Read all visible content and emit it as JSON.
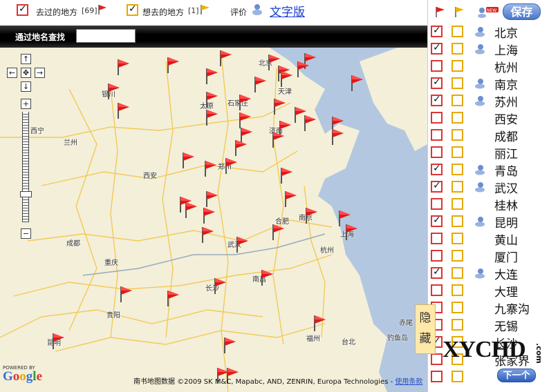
{
  "topbar": {
    "visited_label": "去过的地方",
    "visited_count": "[69]",
    "wish_label": "想去的地方",
    "wish_count": "[1]",
    "rate_label": "评价",
    "text_version_link": "文字版"
  },
  "search": {
    "label": "通过地名查找",
    "placeholder": ""
  },
  "map": {
    "cities": [
      "北京",
      "银川",
      "太原",
      "石家庄",
      "天津",
      "西宁",
      "兰州",
      "济南",
      "郑州",
      "西安",
      "合肥",
      "南京",
      "上海",
      "成都",
      "武汉",
      "杭州",
      "重庆",
      "长沙",
      "南昌",
      "贵阳",
      "福州",
      "台北",
      "赤尾",
      "钓鱼岛",
      "昆明"
    ],
    "powered_by": "POWERED BY",
    "provider_logo": "Google",
    "attribution": "南书地图数据 ©2009 SK M&C, Mapabc, AND, ZENRIN, Europa Technologies - ",
    "terms_link": "使用条款",
    "hide_tab": [
      "隐",
      "藏"
    ],
    "land_color": "#f3efd9",
    "sea_color": "#b3c7e0"
  },
  "zoom": {
    "up": "↑",
    "left": "←",
    "center": "✥",
    "right": "→",
    "down": "↓",
    "zoom_in": "+",
    "zoom_out": "−"
  },
  "panel": {
    "visited_header_icon": "red-flag-icon",
    "wish_header_icon": "yellow-flag-icon",
    "rate_header_icon": "new-rating-icon",
    "save_label": "保存",
    "next_label": "下一个",
    "rows": [
      {
        "name": "北京",
        "visited": true,
        "wish": false,
        "rated": true
      },
      {
        "name": "上海",
        "visited": true,
        "wish": false,
        "rated": true
      },
      {
        "name": "杭州",
        "visited": false,
        "wish": false,
        "rated": false
      },
      {
        "name": "南京",
        "visited": true,
        "wish": false,
        "rated": true
      },
      {
        "name": "苏州",
        "visited": true,
        "wish": false,
        "rated": true
      },
      {
        "name": "西安",
        "visited": false,
        "wish": false,
        "rated": false
      },
      {
        "name": "成都",
        "visited": false,
        "wish": false,
        "rated": false
      },
      {
        "name": "丽江",
        "visited": false,
        "wish": false,
        "rated": false
      },
      {
        "name": "青岛",
        "visited": true,
        "wish": false,
        "rated": true
      },
      {
        "name": "武汉",
        "visited": true,
        "wish": false,
        "rated": true
      },
      {
        "name": "桂林",
        "visited": false,
        "wish": false,
        "rated": false
      },
      {
        "name": "昆明",
        "visited": true,
        "wish": false,
        "rated": true
      },
      {
        "name": "黄山",
        "visited": false,
        "wish": false,
        "rated": false
      },
      {
        "name": "厦门",
        "visited": false,
        "wish": false,
        "rated": false
      },
      {
        "name": "大连",
        "visited": true,
        "wish": false,
        "rated": true
      },
      {
        "name": "大理",
        "visited": false,
        "wish": false,
        "rated": false
      },
      {
        "name": "九寨沟",
        "visited": false,
        "wish": false,
        "rated": false
      },
      {
        "name": "无锡",
        "visited": false,
        "wish": false,
        "rated": false
      },
      {
        "name": "长沙",
        "visited": true,
        "wish": false,
        "rated": false
      },
      {
        "name": "张家界",
        "visited": false,
        "wish": false,
        "rated": false
      },
      {
        "name": "",
        "visited": false,
        "wish": false,
        "rated": false
      }
    ]
  },
  "watermark": {
    "text": "XYCHD",
    "suffix": ".com"
  },
  "colors": {
    "visited": "#dd3333",
    "wish": "#e6a800",
    "save": "#4a76c8"
  }
}
